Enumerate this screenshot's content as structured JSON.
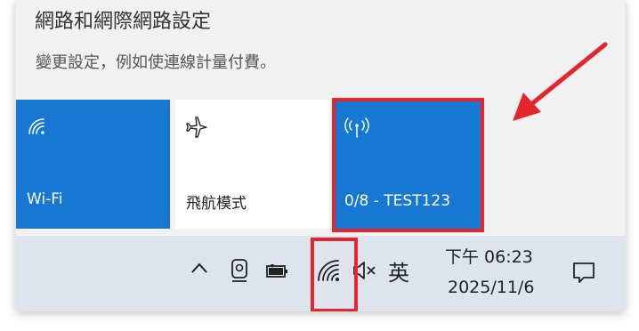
{
  "panel": {
    "title": "網路和網際網路設定",
    "subtitle": "變更設定，例如使連線計量付費。"
  },
  "tiles": [
    {
      "label": "Wi-Fi",
      "icon": "wifi-icon",
      "state": "on"
    },
    {
      "label": "飛航模式",
      "icon": "airplane-icon",
      "state": "off"
    },
    {
      "label": "0/8 - TEST123",
      "icon": "hotspot-icon",
      "state": "on"
    }
  ],
  "taskbar": {
    "ime": "英",
    "time": "下午 06:23",
    "date": "2025/11/6",
    "icons": [
      "chevron-up-icon",
      "camera-icon",
      "battery-icon",
      "wifi-icon",
      "speaker-muted-icon",
      "notification-icon"
    ]
  },
  "colors": {
    "accent": "#1778d4",
    "annotation_red": "#e4262c",
    "taskbar_bg": "#dde4ee",
    "panel_bg": "#f1f1f1"
  }
}
